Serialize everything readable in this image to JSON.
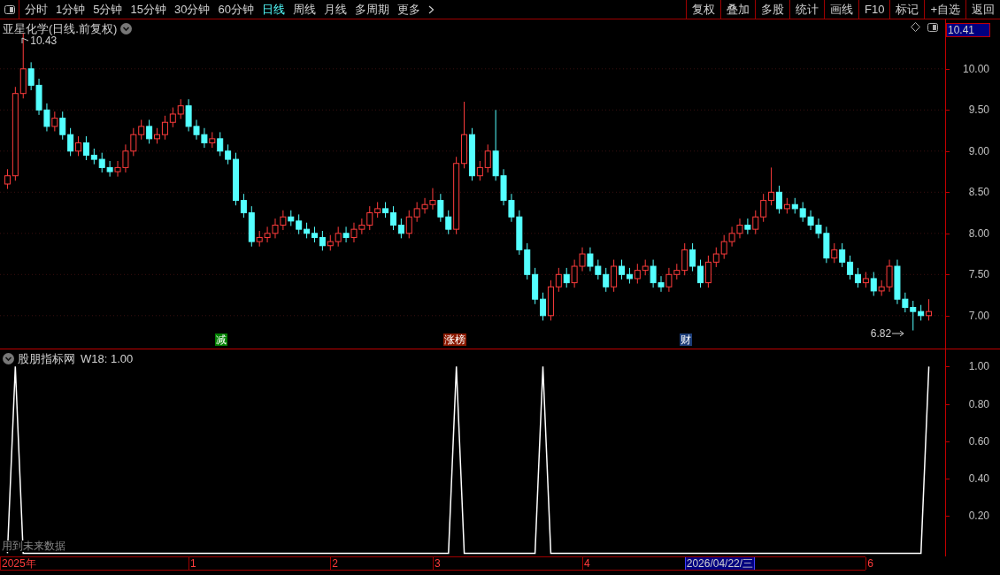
{
  "toolbar": {
    "periods": [
      {
        "label": "分时",
        "selected": false
      },
      {
        "label": "1分钟",
        "selected": false
      },
      {
        "label": "5分钟",
        "selected": false
      },
      {
        "label": "15分钟",
        "selected": false
      },
      {
        "label": "30分钟",
        "selected": false
      },
      {
        "label": "60分钟",
        "selected": false
      },
      {
        "label": "日线",
        "selected": true
      },
      {
        "label": "周线",
        "selected": false
      },
      {
        "label": "月线",
        "selected": false
      },
      {
        "label": "多周期",
        "selected": false
      },
      {
        "label": "更多",
        "selected": false
      }
    ],
    "buttons": [
      "复权",
      "叠加",
      "多股",
      "统计",
      "画线",
      "F10",
      "标记",
      "+自选",
      "返回"
    ]
  },
  "price_panel": {
    "title": "亚星化学(日线.前复权)",
    "current_price": "10.41",
    "high_label": {
      "text": "10.43"
    },
    "low_label": {
      "text": "6.82"
    },
    "markers": [
      {
        "text": "减",
        "color": "#008000"
      },
      {
        "text": "涨榜",
        "color": "#8b1a00"
      },
      {
        "text": "财",
        "color": "#1c3d78"
      }
    ],
    "chart_data": {
      "type": "candlestick",
      "ylim": [
        6.6,
        10.6
      ],
      "grid": true,
      "yticks": [
        {
          "value": 7,
          "label": "7.00"
        },
        {
          "value": 7.5,
          "label": "7.50"
        },
        {
          "value": 8,
          "label": "8.00"
        },
        {
          "value": 8.5,
          "label": "8.50"
        },
        {
          "value": 9,
          "label": "9.00"
        },
        {
          "value": 9.5,
          "label": "9.50"
        },
        {
          "value": 10,
          "label": "10.00"
        }
      ],
      "ohlc": [
        [
          8.6,
          8.78,
          8.54,
          8.7
        ],
        [
          8.7,
          9.78,
          8.64,
          9.7
        ],
        [
          9.7,
          10.43,
          9.64,
          10.0
        ],
        [
          10.0,
          10.08,
          9.74,
          9.8
        ],
        [
          9.8,
          9.88,
          9.44,
          9.5
        ],
        [
          9.5,
          9.58,
          9.24,
          9.3
        ],
        [
          9.3,
          9.48,
          9.24,
          9.4
        ],
        [
          9.4,
          9.48,
          9.14,
          9.2
        ],
        [
          9.2,
          9.28,
          8.94,
          9.0
        ],
        [
          9.0,
          9.18,
          8.94,
          9.1
        ],
        [
          9.1,
          9.18,
          8.89,
          8.95
        ],
        [
          8.95,
          9.03,
          8.84,
          8.9
        ],
        [
          8.9,
          8.98,
          8.74,
          8.8
        ],
        [
          8.8,
          8.88,
          8.69,
          8.75
        ],
        [
          8.75,
          8.88,
          8.69,
          8.8
        ],
        [
          8.8,
          9.08,
          8.74,
          9.0
        ],
        [
          9.0,
          9.28,
          8.94,
          9.2
        ],
        [
          9.2,
          9.38,
          9.14,
          9.3
        ],
        [
          9.3,
          9.38,
          9.09,
          9.15
        ],
        [
          9.15,
          9.28,
          9.09,
          9.2
        ],
        [
          9.2,
          9.43,
          9.14,
          9.35
        ],
        [
          9.35,
          9.53,
          9.29,
          9.45
        ],
        [
          9.45,
          9.63,
          9.39,
          9.55
        ],
        [
          9.55,
          9.63,
          9.24,
          9.3
        ],
        [
          9.3,
          9.38,
          9.14,
          9.2
        ],
        [
          9.2,
          9.28,
          9.04,
          9.1
        ],
        [
          9.1,
          9.23,
          9.04,
          9.15
        ],
        [
          9.15,
          9.23,
          8.94,
          9.0
        ],
        [
          9.0,
          9.08,
          8.84,
          8.9
        ],
        [
          8.9,
          8.98,
          8.34,
          8.4
        ],
        [
          8.4,
          8.48,
          8.19,
          8.25
        ],
        [
          8.25,
          8.33,
          7.84,
          7.9
        ],
        [
          7.9,
          8.03,
          7.84,
          7.95
        ],
        [
          7.95,
          8.08,
          7.89,
          8.0
        ],
        [
          8.0,
          8.18,
          7.94,
          8.1
        ],
        [
          8.1,
          8.28,
          8.04,
          8.2
        ],
        [
          8.2,
          8.28,
          8.09,
          8.15
        ],
        [
          8.15,
          8.23,
          7.99,
          8.05
        ],
        [
          8.05,
          8.13,
          7.94,
          8.0
        ],
        [
          8.0,
          8.08,
          7.89,
          7.95
        ],
        [
          7.95,
          8.03,
          7.79,
          7.85
        ],
        [
          7.85,
          7.98,
          7.79,
          7.9
        ],
        [
          7.9,
          8.08,
          7.84,
          8.0
        ],
        [
          8.0,
          8.08,
          7.89,
          7.95
        ],
        [
          7.95,
          8.13,
          7.89,
          8.05
        ],
        [
          8.05,
          8.18,
          7.99,
          8.1
        ],
        [
          8.1,
          8.33,
          8.04,
          8.25
        ],
        [
          8.25,
          8.38,
          8.19,
          8.3
        ],
        [
          8.3,
          8.38,
          8.19,
          8.25
        ],
        [
          8.25,
          8.33,
          8.04,
          8.1
        ],
        [
          8.1,
          8.18,
          7.94,
          8.0
        ],
        [
          8.0,
          8.28,
          7.94,
          8.2
        ],
        [
          8.2,
          8.38,
          8.14,
          8.3
        ],
        [
          8.3,
          8.43,
          8.24,
          8.35
        ],
        [
          8.35,
          8.55,
          8.29,
          8.4
        ],
        [
          8.4,
          8.48,
          8.14,
          8.2
        ],
        [
          8.2,
          8.28,
          7.99,
          8.05
        ],
        [
          8.05,
          8.93,
          7.99,
          8.85
        ],
        [
          8.85,
          9.6,
          8.79,
          9.2
        ],
        [
          9.2,
          9.28,
          8.64,
          8.7
        ],
        [
          8.7,
          8.88,
          8.64,
          8.8
        ],
        [
          8.8,
          9.08,
          8.74,
          9.0
        ],
        [
          9.0,
          9.5,
          8.64,
          8.7
        ],
        [
          8.7,
          8.78,
          8.34,
          8.4
        ],
        [
          8.4,
          8.48,
          8.14,
          8.2
        ],
        [
          8.2,
          8.28,
          7.74,
          7.8
        ],
        [
          7.8,
          7.88,
          7.44,
          7.5
        ],
        [
          7.5,
          7.58,
          7.14,
          7.2
        ],
        [
          7.2,
          7.28,
          6.94,
          7.0
        ],
        [
          7.0,
          7.43,
          6.94,
          7.35
        ],
        [
          7.35,
          7.58,
          7.29,
          7.5
        ],
        [
          7.5,
          7.58,
          7.34,
          7.4
        ],
        [
          7.4,
          7.68,
          7.34,
          7.6
        ],
        [
          7.6,
          7.83,
          7.54,
          7.75
        ],
        [
          7.75,
          7.83,
          7.54,
          7.6
        ],
        [
          7.6,
          7.68,
          7.44,
          7.5
        ],
        [
          7.5,
          7.58,
          7.29,
          7.35
        ],
        [
          7.35,
          7.68,
          7.29,
          7.6
        ],
        [
          7.6,
          7.68,
          7.44,
          7.5
        ],
        [
          7.5,
          7.58,
          7.39,
          7.45
        ],
        [
          7.45,
          7.63,
          7.39,
          7.55
        ],
        [
          7.55,
          7.68,
          7.49,
          7.6
        ],
        [
          7.6,
          7.68,
          7.34,
          7.4
        ],
        [
          7.4,
          7.48,
          7.29,
          7.35
        ],
        [
          7.35,
          7.58,
          7.29,
          7.5
        ],
        [
          7.5,
          7.63,
          7.44,
          7.55
        ],
        [
          7.55,
          7.88,
          7.49,
          7.8
        ],
        [
          7.8,
          7.88,
          7.54,
          7.6
        ],
        [
          7.6,
          7.68,
          7.34,
          7.4
        ],
        [
          7.4,
          7.73,
          7.34,
          7.65
        ],
        [
          7.65,
          7.83,
          7.59,
          7.75
        ],
        [
          7.75,
          7.98,
          7.69,
          7.9
        ],
        [
          7.9,
          8.08,
          7.84,
          8.0
        ],
        [
          8.0,
          8.18,
          7.94,
          8.1
        ],
        [
          8.1,
          8.18,
          7.99,
          8.05
        ],
        [
          8.05,
          8.28,
          7.99,
          8.2
        ],
        [
          8.2,
          8.48,
          8.14,
          8.4
        ],
        [
          8.4,
          8.8,
          8.34,
          8.5
        ],
        [
          8.5,
          8.58,
          8.24,
          8.3
        ],
        [
          8.3,
          8.43,
          8.24,
          8.35
        ],
        [
          8.35,
          8.43,
          8.24,
          8.3
        ],
        [
          8.3,
          8.38,
          8.14,
          8.2
        ],
        [
          8.2,
          8.28,
          8.04,
          8.1
        ],
        [
          8.1,
          8.18,
          7.94,
          8.0
        ],
        [
          8.0,
          8.08,
          7.64,
          7.7
        ],
        [
          7.7,
          7.88,
          7.64,
          7.8
        ],
        [
          7.8,
          7.88,
          7.59,
          7.65
        ],
        [
          7.65,
          7.73,
          7.44,
          7.5
        ],
        [
          7.5,
          7.58,
          7.34,
          7.4
        ],
        [
          7.4,
          7.53,
          7.34,
          7.45
        ],
        [
          7.45,
          7.53,
          7.24,
          7.3
        ],
        [
          7.3,
          7.43,
          7.24,
          7.35
        ],
        [
          7.35,
          7.68,
          7.29,
          7.6
        ],
        [
          7.6,
          7.68,
          7.14,
          7.2
        ],
        [
          7.2,
          7.28,
          7.04,
          7.1
        ],
        [
          7.1,
          7.18,
          6.82,
          7.05
        ],
        [
          7.05,
          7.13,
          6.94,
          7.0
        ],
        [
          7.0,
          7.2,
          6.94,
          7.05
        ]
      ]
    }
  },
  "indicator_panel": {
    "title": "股朋指标网",
    "reading": "W18: 1.00",
    "note": "用到未来数据",
    "chart_data": {
      "type": "line",
      "ylim": [
        -0.017,
        1.092
      ],
      "yticks": [
        {
          "value": 0.2,
          "label": "0.20"
        },
        {
          "value": 0.4,
          "label": "0.40"
        },
        {
          "value": 0.6,
          "label": "0.60"
        },
        {
          "value": 0.8,
          "label": "0.80"
        },
        {
          "value": 1,
          "label": "1.00"
        }
      ],
      "series": [
        {
          "color": "#ffffff",
          "values": [
            0,
            1,
            0,
            0,
            0,
            0,
            0,
            0,
            0,
            0,
            0,
            0,
            0,
            0,
            0,
            0,
            0,
            0,
            0,
            0,
            0,
            0,
            0,
            0,
            0,
            0,
            0,
            0,
            0,
            0,
            0,
            0,
            0,
            0,
            0,
            0,
            0,
            0,
            0,
            0,
            0,
            0,
            0,
            0,
            0,
            0,
            0,
            0,
            0,
            0,
            0,
            0,
            0,
            0,
            0,
            0,
            0,
            1,
            0,
            0,
            0,
            0,
            0,
            0,
            0,
            0,
            0,
            0,
            1,
            0,
            0,
            0,
            0,
            0,
            0,
            0,
            0,
            0,
            0,
            0,
            0,
            0,
            0,
            0,
            0,
            0,
            0,
            0,
            0,
            0,
            0,
            0,
            0,
            0,
            0,
            0,
            0,
            0,
            0,
            0,
            0,
            0,
            0,
            0,
            0,
            0,
            0,
            0,
            0,
            0,
            0,
            0,
            0,
            0,
            0,
            0,
            0,
            1
          ]
        }
      ]
    }
  },
  "date_axis": [
    {
      "text": "2025年",
      "selected": false
    },
    {
      "text": "1",
      "selected": false
    },
    {
      "text": "2",
      "selected": false
    },
    {
      "text": "3",
      "selected": false
    },
    {
      "text": "4",
      "selected": false
    },
    {
      "text": "2026/04/22/三",
      "selected": true
    },
    {
      "text": "6",
      "selected": false
    }
  ]
}
